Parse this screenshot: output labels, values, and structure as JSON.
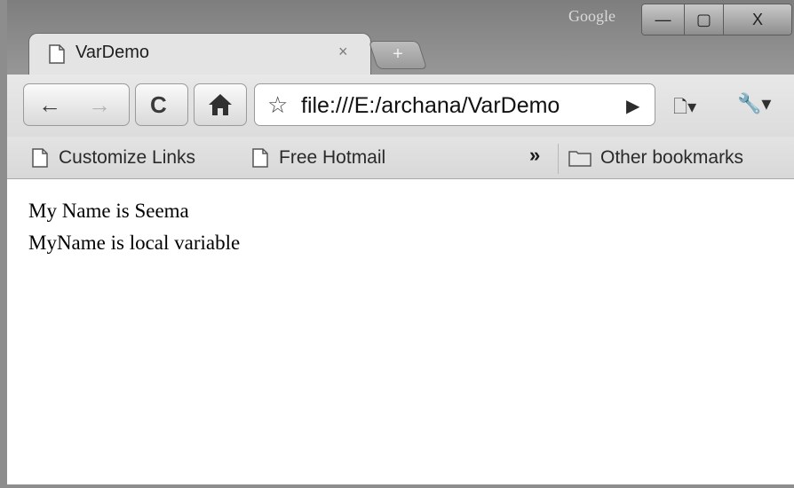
{
  "titlebar": {
    "brand_label": "Google",
    "minimize_glyph": "—",
    "maximize_glyph": "▢",
    "close_glyph": "X"
  },
  "tab": {
    "title": "VarDemo",
    "close_glyph": "×",
    "icon": "page-icon"
  },
  "new_tab": {
    "glyph": "+",
    "icon": "new-tab-icon"
  },
  "toolbar": {
    "back_glyph": "←",
    "forward_glyph": "→",
    "reload_glyph": "C",
    "home_glyph": "⌂",
    "star_glyph": "☆",
    "url": "file:///E:/archana/VarDemo",
    "go_glyph": "▶",
    "page_menu_glyph": "🗋▾",
    "tools_menu_glyph": "🔧▾"
  },
  "bookmarks": {
    "items": [
      {
        "label": "Customize Links",
        "icon": "page-icon"
      },
      {
        "label": "Free Hotmail",
        "icon": "page-icon"
      }
    ],
    "overflow_glyph": "»",
    "other": {
      "label": "Other bookmarks",
      "icon": "folder-icon"
    }
  },
  "page": {
    "lines": [
      "My Name is Seema",
      "MyName is local variable"
    ]
  }
}
